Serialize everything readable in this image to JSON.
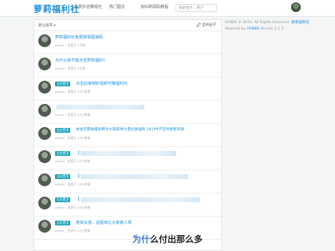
{
  "header": {
    "brand": "萝莉福利社",
    "nav": [
      "免费抖音赚钱社",
      "热门图文",
      "加红刷源码教程"
    ],
    "search_placeholder": "搜索帖子、用户"
  },
  "panel": {
    "sort_label": "默认排序",
    "post_button": "发布帖子"
  },
  "topics": [
    {
      "tag": "",
      "title": "萝莉福利社免费获得图速码",
      "author": "admin",
      "time": "发表于 1天前",
      "blurred": false
    },
    {
      "tag": "",
      "title": "为什么我不能点击萝莉福利?",
      "author": "admin",
      "time": "发表于 1天前",
      "blurred": false
    },
    {
      "tag": "全站置顶",
      "title": "点击此得到好视频可赚福利元",
      "author": "admin",
      "time": "发表于 23小时前",
      "blurred": false
    },
    {
      "tag": "",
      "title": "",
      "author": "admin",
      "time": "发表于 23小时前",
      "blurred": true
    },
    {
      "tag": "全站置顶",
      "title": "本站无需举报免费为大家提供大量优质福利 24小时不定时更新资源",
      "author": "admin",
      "time": "发表于 23小时前",
      "blurred": false
    },
    {
      "tag": "全站置顶",
      "title": "【",
      "author": "admin",
      "time": "发表于 23小时前",
      "blurred": true
    },
    {
      "tag": "全站置顶",
      "title": "【",
      "author": "admin",
      "time": "发表于 23小时前",
      "blurred": true
    },
    {
      "tag": "全站置顶",
      "title": "【",
      "author": "admin",
      "time": "发表于 23小时前",
      "blurred": true
    },
    {
      "tag": "全站置顶",
      "title": "管家女孩，这题目比大家被人哭",
      "author": "admin",
      "time": "发表于 23小时前",
      "blurred": false
    }
  ],
  "sidebar": {
    "copyright_prefix": "HYBBS © 2016. All Rights Reserved.",
    "site_link": "萝莉福利社",
    "powered_prefix": "Powered by",
    "powered_link": "HYBBS",
    "version": "Version 2.1.3"
  },
  "watermark": {
    "highlight": "为什",
    "rest": "么付出那么多"
  },
  "colors": {
    "brand": "#1e8fdc",
    "tag": "#16a2b8"
  }
}
